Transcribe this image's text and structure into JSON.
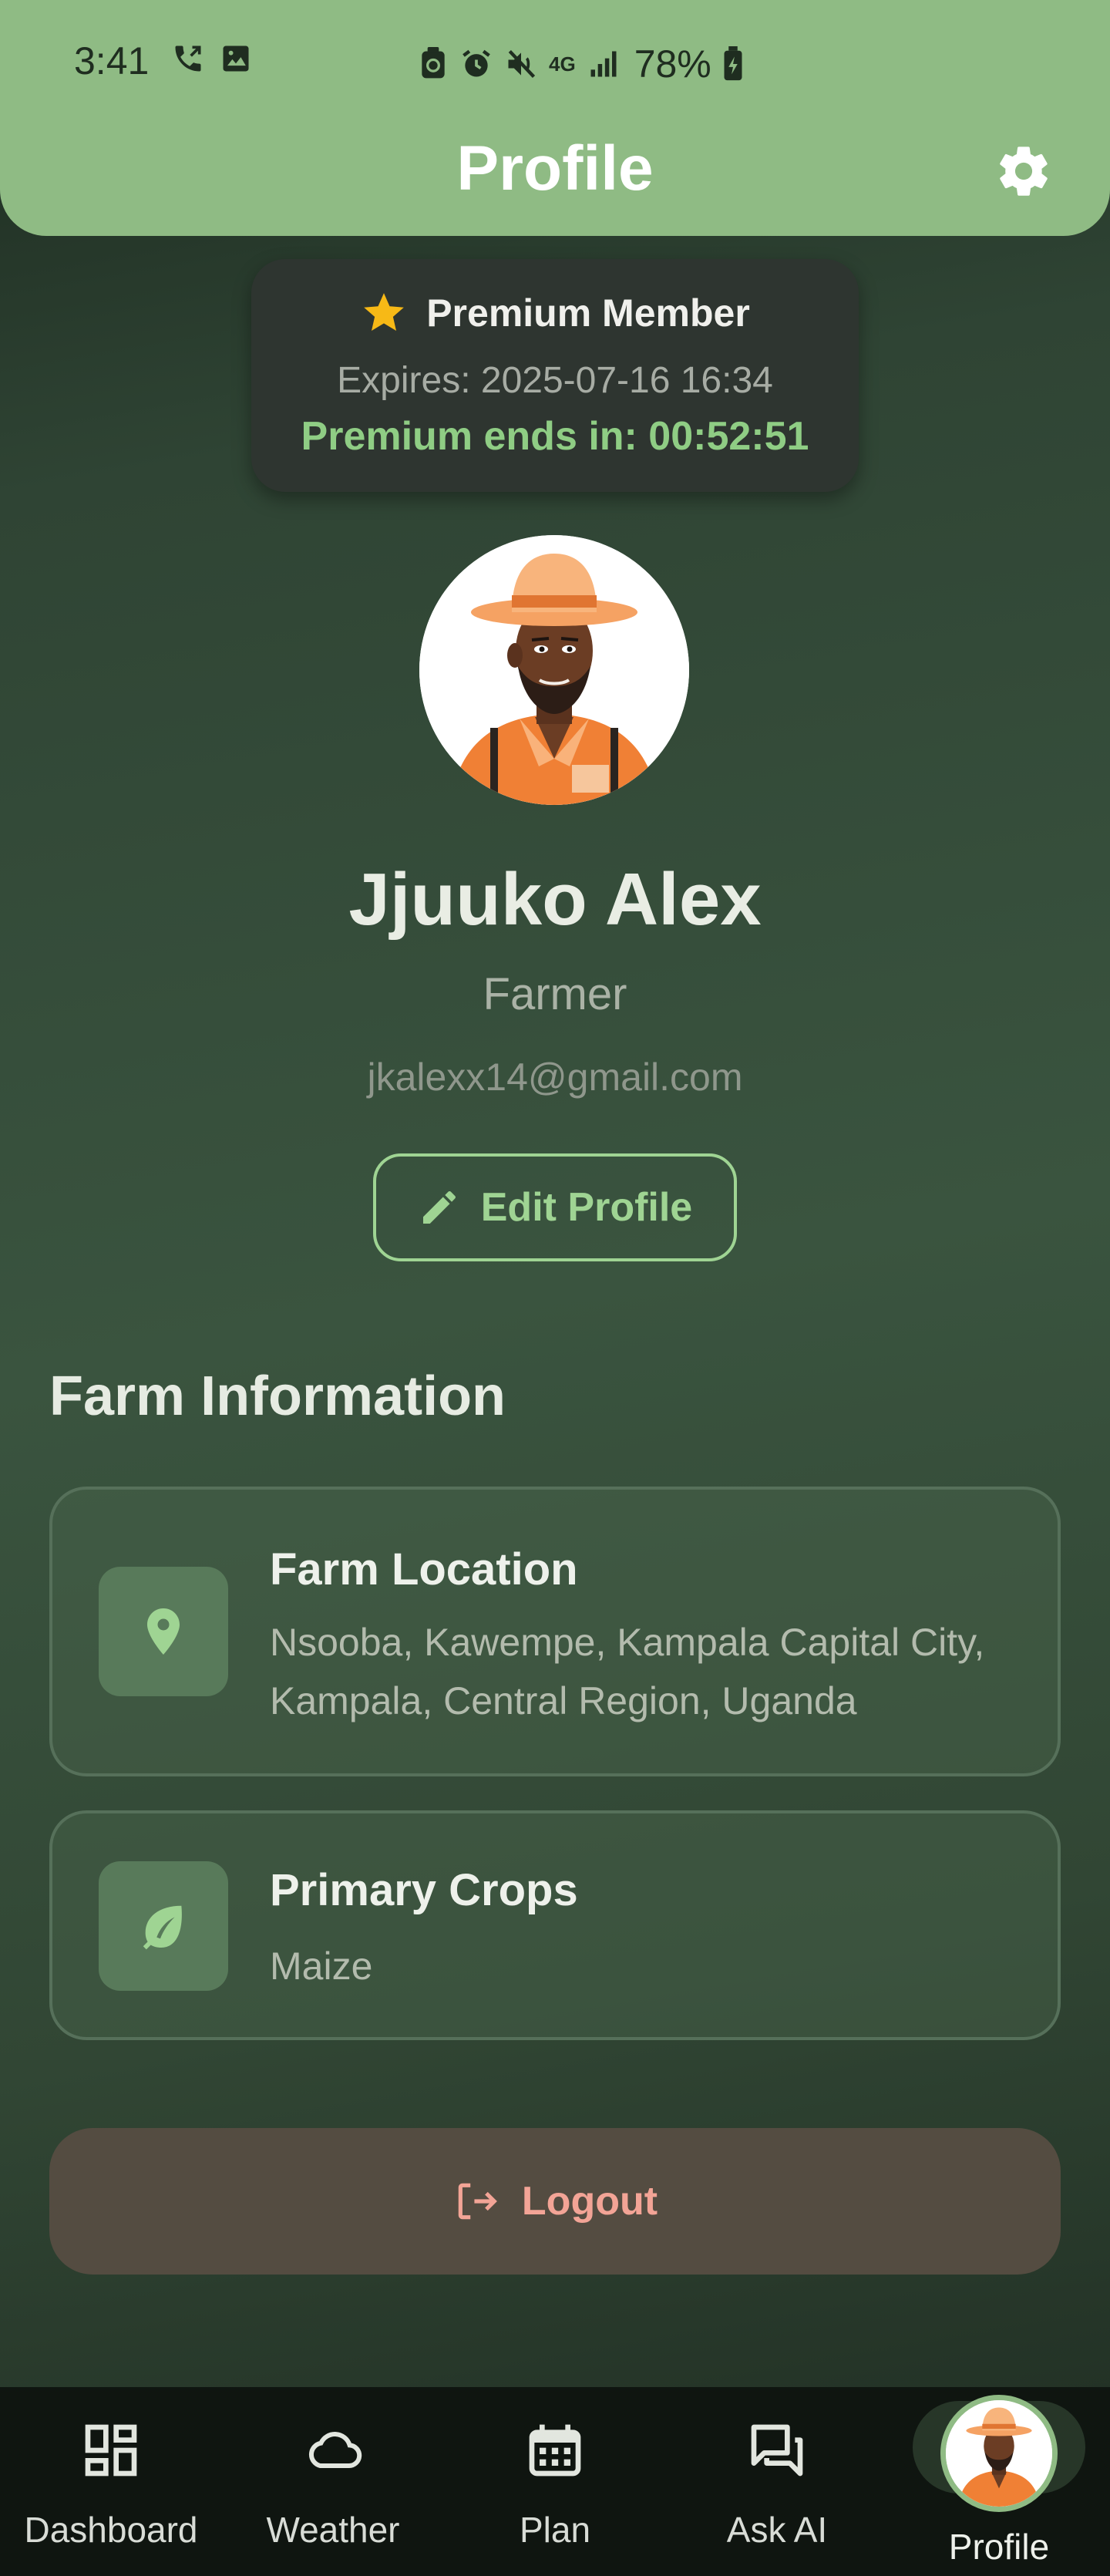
{
  "status_bar": {
    "time": "3:41",
    "network": "4G",
    "battery": "78%"
  },
  "header": {
    "title": "Profile",
    "settings_icon": "gear-icon"
  },
  "premium": {
    "title": "Premium Member",
    "expires": "Expires: 2025-07-16 16:34",
    "countdown": "Premium ends in: 00:52:51",
    "accent_color": "#8fcd84",
    "star_color": "#f7b916"
  },
  "profile": {
    "name": "Jjuuko Alex",
    "role": "Farmer",
    "email": "jkalexx14@gmail.com",
    "edit_label": "Edit Profile"
  },
  "farm": {
    "section_title": "Farm Information",
    "location_label": "Farm Location",
    "location_value": "Nsooba, Kawempe, Kampala Capital City, Kampala, Central Region, Uganda",
    "crops_label": "Primary Crops",
    "crops_value": "Maize"
  },
  "logout": {
    "label": "Logout",
    "color": "#f3a496"
  },
  "nav": {
    "items": [
      {
        "label": "Dashboard",
        "icon": "dashboard-icon"
      },
      {
        "label": "Weather",
        "icon": "cloud-icon"
      },
      {
        "label": "Plan",
        "icon": "calendar-icon"
      },
      {
        "label": "Ask AI",
        "icon": "chat-icon"
      },
      {
        "label": "Profile",
        "icon": "avatar",
        "active": true
      }
    ]
  },
  "colors": {
    "header_bg": "#8fbb84",
    "nav_bg": "#0f1510"
  }
}
